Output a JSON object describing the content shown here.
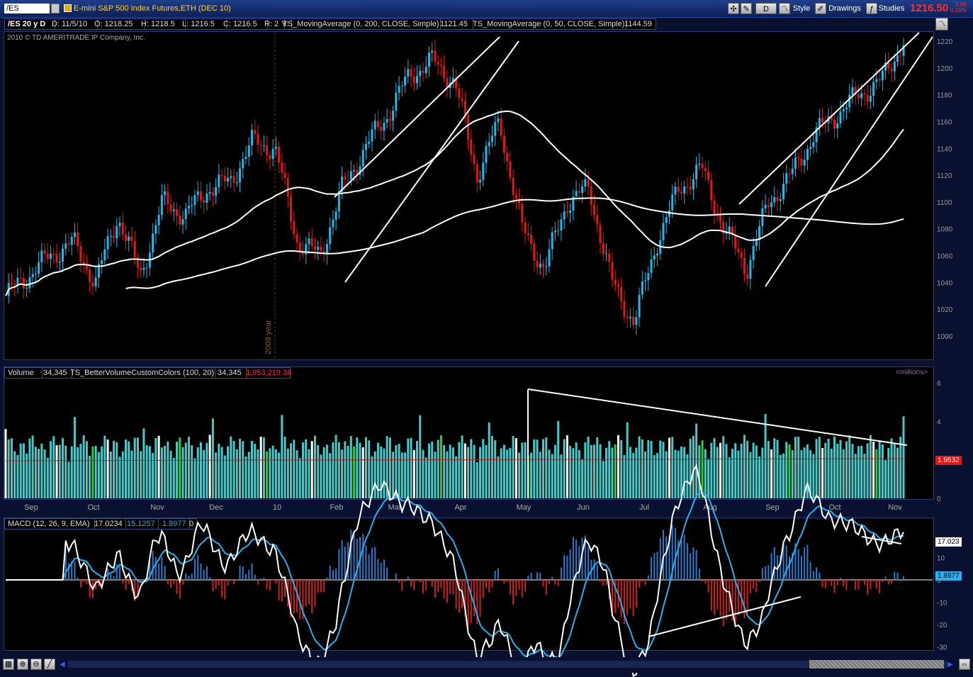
{
  "toolbar": {
    "symbol": "/ES",
    "title": "E-mini S&P 500 Index Futures,ETH (DEC 10)",
    "period_button": "D",
    "style_label": "Style",
    "drawings_label": "Drawings",
    "studies_label": "Studies",
    "last_price": "1216.50",
    "change_top": "2.00",
    "change_bottom": "0.16%"
  },
  "info": {
    "aggregation": "/ES 20 y D",
    "date": "D: 11/5/10",
    "open": "O: 1218.25",
    "high": "H: 1218.5",
    "low": "L: 1216.5",
    "close": "C: 1216.5",
    "range": "R: 2",
    "y": "Y:",
    "ma200_label": "TS_MovingAverage (0, 200, CLOSE, Simple)",
    "ma200_value": "1121.45",
    "ma50_label": "TS_MovingAverage (0, 50, CLOSE, Simple)",
    "ma50_value": "1144.59",
    "copyright": "2010 © TD AMERITRADE IP Company, Inc.",
    "year_marker": "2009 year"
  },
  "volume": {
    "label": "Volume",
    "value": "34,345",
    "study": "TS_BetterVolumeCustomColors (100, 20)",
    "study_value": "34,345",
    "study_value2": "1,953,219.36",
    "units": "<millions>",
    "avg_tag": "1.9532"
  },
  "macd": {
    "label": "MACD (12, 26, 9, EMA)",
    "value": "17.0234",
    "avg": "15.1257",
    "diff": "1.8977",
    "zero": "0",
    "value_tag": "17.023",
    "diff_tag": "1.8977"
  },
  "chart_data": {
    "type": "candlestick",
    "price_ticks": [
      1000,
      1020,
      1040,
      1060,
      1080,
      1100,
      1120,
      1140,
      1160,
      1180,
      1200,
      1220
    ],
    "volume_ticks": [
      0,
      2,
      4,
      6
    ],
    "macd_ticks": [
      -30,
      -20,
      -10,
      0,
      10,
      20
    ],
    "months": [
      "Sep",
      "Oct",
      "Nov",
      "Dec",
      "10",
      "Feb",
      "Mar",
      "Apr",
      "May",
      "Jun",
      "Jul",
      "Aug",
      "Sep",
      "Oct",
      "Nov"
    ],
    "close_path": [
      [
        "Sep",
        1030
      ],
      [
        "Sep",
        1045
      ],
      [
        "Oct",
        1060
      ],
      [
        "Oct",
        1070
      ],
      [
        "Oct",
        1040
      ],
      [
        "Nov",
        1090
      ],
      [
        "Nov",
        1045
      ],
      [
        "Dec",
        1100
      ],
      [
        "Dec",
        1090
      ],
      [
        "Dec",
        1110
      ],
      [
        "10",
        1115
      ],
      [
        "10",
        1145
      ],
      [
        "10",
        1140
      ],
      [
        "Feb",
        1070
      ],
      [
        "Feb",
        1060
      ],
      [
        "Mar",
        1110
      ],
      [
        "Mar",
        1140
      ],
      [
        "Apr",
        1165
      ],
      [
        "Apr",
        1195
      ],
      [
        "Apr",
        1205
      ],
      [
        "May",
        1190
      ],
      [
        "May",
        1120
      ],
      [
        "May",
        1160
      ],
      [
        "Jun",
        1080
      ],
      [
        "Jun",
        1050
      ],
      [
        "Jun",
        1100
      ],
      [
        "Jun",
        1110
      ],
      [
        "Jul",
        1040
      ],
      [
        "Jul",
        1010
      ],
      [
        "Jul",
        1070
      ],
      [
        "Aug",
        1110
      ],
      [
        "Aug",
        1125
      ],
      [
        "Aug",
        1080
      ],
      [
        "Sep",
        1050
      ],
      [
        "Sep",
        1100
      ],
      [
        "Sep",
        1120
      ],
      [
        "Oct",
        1150
      ],
      [
        "Oct",
        1165
      ],
      [
        "Oct",
        1180
      ],
      [
        "Nov",
        1190
      ],
      [
        "Nov",
        1220
      ]
    ],
    "ma50_last": 1144.59,
    "ma200_last": 1121.45,
    "volume_avg_millions": 1.9532,
    "volume_max_millions": 5.8,
    "macd_range": [
      -30,
      20
    ]
  },
  "colors": {
    "up": "#22b8e8",
    "down": "#e01818",
    "ma": "#ffffff",
    "ma_red": "#8a1a1a",
    "macd_line": "#ffffff",
    "macd_signal": "#2ab0f0",
    "hist_pos": "#2a7acc",
    "hist_neg": "#cc2222"
  }
}
